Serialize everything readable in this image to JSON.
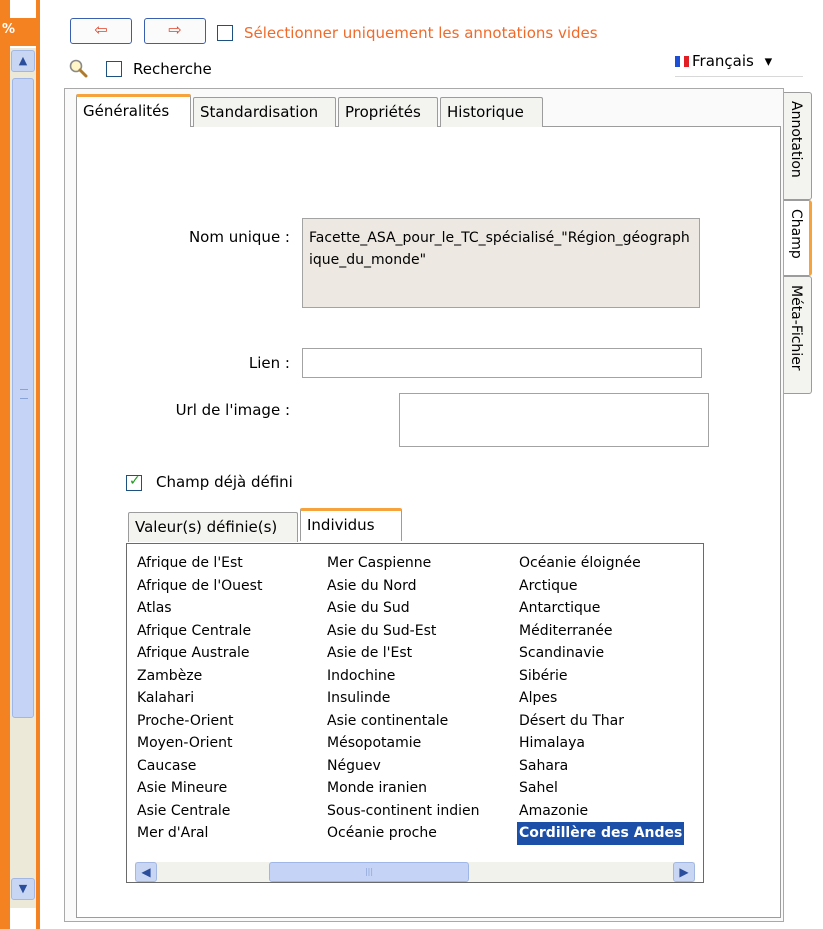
{
  "left": {
    "percent_label": "%",
    "scroll_up": "▲",
    "scroll_down": "▼"
  },
  "toolbar": {
    "prev_icon": "arrow-left-icon",
    "next_icon": "arrow-right-icon",
    "prev_glyph": "⇦",
    "next_glyph": "⇨",
    "only_empty_label": "Sélectionner uniquement les annotations vides",
    "search_label": "Recherche",
    "language": "Français",
    "language_caret": "▾",
    "accent_color": "#f06a2a"
  },
  "tabs": [
    "Généralités",
    "Standardisation",
    "Propriétés",
    "Historique"
  ],
  "side_tabs": [
    "Annotation",
    "Champ",
    "Méta-Fichier"
  ],
  "form": {
    "unique_name_label": "Nom unique :",
    "unique_name_value": "Facette_ASA_pour_le_TC_spécialisé_\"Région_géographique_du_monde\"",
    "link_label": "Lien :",
    "link_value": "",
    "image_url_label": "Url de l'image :",
    "image_url_value": "",
    "defined_field_label": "Champ déjà défini",
    "defined_field_checked": true
  },
  "inner_tabs": [
    "Valeur(s) définie(s)",
    "Individus"
  ],
  "individuals": {
    "col1": [
      "Afrique de l'Est",
      "Afrique de l'Ouest",
      "Atlas",
      "Afrique Centrale",
      "Afrique Australe",
      "Zambèze",
      "Kalahari",
      "Proche-Orient",
      "Moyen-Orient",
      "Caucase",
      "Asie Mineure",
      "Asie Centrale",
      "Mer d'Aral"
    ],
    "col2": [
      "Mer Caspienne",
      "Asie du Nord",
      "Asie du Sud",
      "Asie du Sud-Est",
      "Asie de l'Est",
      "Indochine",
      "Insulinde",
      "Asie continentale",
      "Mésopotamie",
      "Néguev",
      "Monde iranien",
      "Sous-continent indien",
      "Océanie proche"
    ],
    "col3": [
      "Océanie éloignée",
      "Arctique",
      "Antarctique",
      "Méditerranée",
      "Scandinavie",
      "Sibérie",
      "Alpes",
      "Désert du Thar",
      "Himalaya",
      "Sahara",
      "Sahel",
      "Amazonie",
      "Cordillère des Andes"
    ],
    "selected": "Cordillère des Andes",
    "scroll_left": "◀",
    "scroll_right": "▶",
    "thumb_grip": "|||"
  }
}
